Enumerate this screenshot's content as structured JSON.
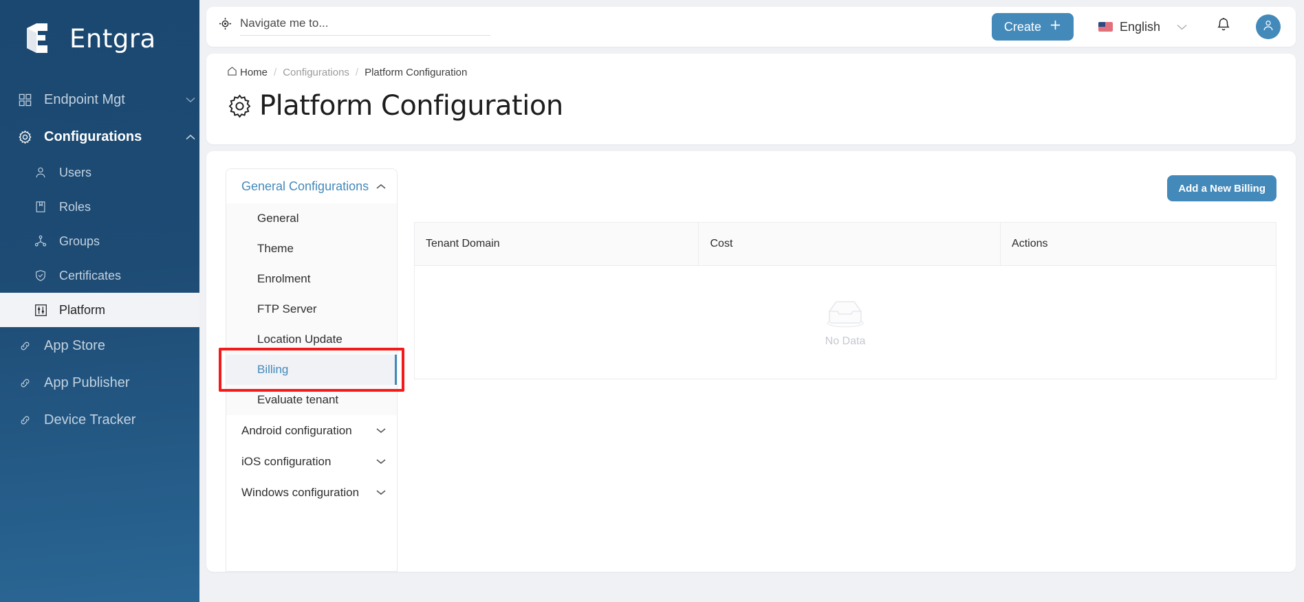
{
  "brand": {
    "name": "Entgra",
    "logo_icon": "entgra-logo-icon"
  },
  "colors": {
    "sidebar": "#1d4b74",
    "accent": "#4389ba",
    "highlight": "#f51a1a"
  },
  "sidebar": {
    "items": [
      {
        "label": "Endpoint Mgt",
        "icon": "grid-icon",
        "caret": "chevron-down-icon",
        "type": "group"
      },
      {
        "label": "Configurations",
        "icon": "gear-icon",
        "caret": "chevron-up-icon",
        "type": "group-open"
      },
      {
        "label": "Users",
        "icon": "user-icon",
        "type": "sub"
      },
      {
        "label": "Roles",
        "icon": "book-icon",
        "type": "sub"
      },
      {
        "label": "Groups",
        "icon": "groups-icon",
        "type": "sub"
      },
      {
        "label": "Certificates",
        "icon": "shield-check-icon",
        "type": "sub"
      },
      {
        "label": "Platform",
        "icon": "sliders-icon",
        "type": "sub-active"
      },
      {
        "label": "App Store",
        "icon": "link-icon",
        "type": "link"
      },
      {
        "label": "App Publisher",
        "icon": "link-icon",
        "type": "link"
      },
      {
        "label": "Device Tracker",
        "icon": "link-icon",
        "type": "link"
      }
    ]
  },
  "topbar": {
    "search": {
      "placeholder": "Navigate me to...",
      "value": "",
      "icon": "target-icon"
    },
    "create_label": "Create",
    "create_icon": "plus-icon",
    "language": "English",
    "language_caret": "chevron-down-icon",
    "bell_icon": "bell-icon",
    "avatar_icon": "user-avatar-icon"
  },
  "breadcrumb": {
    "home": "Home",
    "items": [
      "Configurations",
      "Platform Configuration"
    ],
    "separator": "/"
  },
  "page": {
    "title": "Platform Configuration",
    "title_icon": "gear-icon"
  },
  "config_menu": {
    "header": {
      "label": "General Configurations",
      "caret": "chevron-up-icon"
    },
    "items": [
      {
        "label": "General"
      },
      {
        "label": "Theme"
      },
      {
        "label": "Enrolment"
      },
      {
        "label": "FTP Server"
      },
      {
        "label": "Location Update"
      },
      {
        "label": "Billing",
        "selected": true,
        "highlighted": true
      },
      {
        "label": "Evaluate tenant"
      }
    ],
    "groups": [
      {
        "label": "Android configuration",
        "caret": "chevron-down-icon"
      },
      {
        "label": "iOS configuration",
        "caret": "chevron-down-icon"
      },
      {
        "label": "Windows configuration",
        "caret": "chevron-down-icon"
      }
    ]
  },
  "panel": {
    "add_button": "Add a New Billing",
    "table": {
      "columns": [
        "Tenant Domain",
        "Cost",
        "Actions"
      ],
      "rows": [],
      "empty_text": "No Data",
      "empty_icon": "empty-box-icon"
    }
  }
}
